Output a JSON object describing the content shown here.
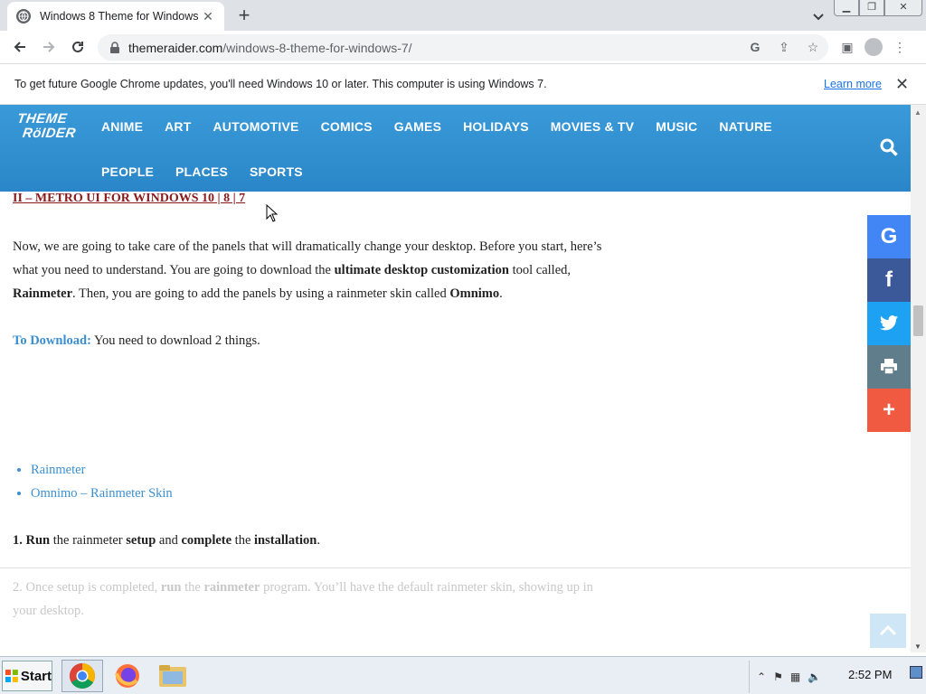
{
  "browser": {
    "tab_title": "Windows 8 Theme for Windows",
    "url_host": "themeraider.com",
    "url_path": "/windows-8-theme-for-windows-7/"
  },
  "infobar": {
    "message": "To get future Google Chrome updates, you'll need Windows 10 or later. This computer is using Windows 7.",
    "learn_more": "Learn more"
  },
  "site": {
    "logo_line1": "THEME",
    "logo_line2": "RöIDER",
    "nav": [
      "ANIME",
      "ART",
      "AUTOMOTIVE",
      "COMICS",
      "GAMES",
      "HOLIDAYS",
      "MOVIES & TV",
      "MUSIC",
      "NATURE",
      "PEOPLE",
      "PLACES",
      "SPORTS"
    ]
  },
  "article": {
    "heading": "II – METRO UI FOR WINDOWS 10 | 8 | 7",
    "p1_a": "Now, we are going to take care of the panels that will dramatically change your desktop. Before you start, here’s what you need to understand. You are going to download the ",
    "p1_b": "ultimate desktop customization",
    "p1_c": " tool called, ",
    "p1_d": "Rainmeter",
    "p1_e": ". Then, you are going to add the panels by using a rainmeter skin called ",
    "p1_f": "Omnimo",
    "p1_g": ".",
    "dl_label": "To Download:",
    "dl_text": " You need to download 2 things.",
    "links": [
      "Rainmeter",
      "Omnimo – Rainmeter Skin"
    ],
    "step1_num": "1. Run",
    "step1_a": " the rainmeter ",
    "step1_b": "setup",
    "step1_c": " and ",
    "step1_d": "complete",
    "step1_e": " the ",
    "step1_f": "installation",
    "step1_g": ".",
    "step2_a": "2. Once setup is completed, ",
    "step2_b": "run",
    "step2_c": " the ",
    "step2_d": "rainmeter",
    "step2_e": " program. You’ll have the default rainmeter skin, showing up in your desktop."
  },
  "social": [
    {
      "icon": "google-icon",
      "glyph": "G",
      "color": "#4285f4"
    },
    {
      "icon": "facebook-icon",
      "glyph": "f",
      "color": "#3b5998"
    },
    {
      "icon": "twitter-icon",
      "glyph": "🐦",
      "color": "#1da1f2"
    },
    {
      "icon": "print-icon",
      "glyph": "⎙",
      "color": "#607d8b"
    },
    {
      "icon": "more-icon",
      "glyph": "+",
      "color": "#f05a40"
    }
  ],
  "taskbar": {
    "start": "Start",
    "clock": "2:52 PM"
  }
}
